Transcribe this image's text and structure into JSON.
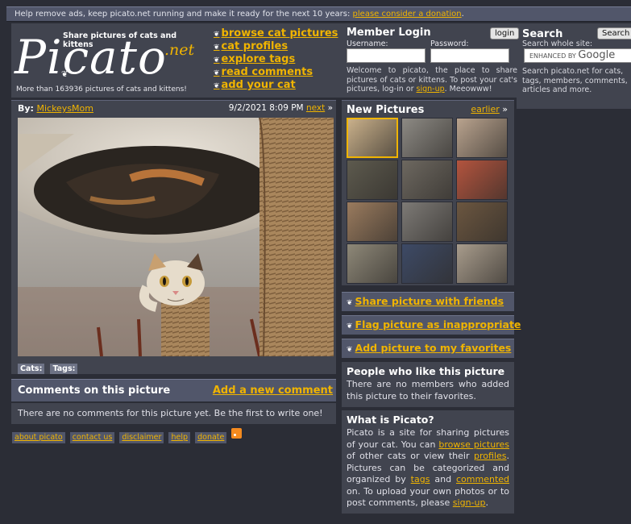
{
  "topbar": {
    "text": "Help remove ads, keep picato.net running and make it ready for the next 10 years:",
    "link": "please consider a donation",
    "tail": "."
  },
  "logo": {
    "tagline": "Share pictures of cats and kittens",
    "word": "Picato",
    "net": ".net",
    "count": "More than 163936 pictures of cats and kittens!"
  },
  "nav": [
    "browse cat pictures",
    "cat profiles",
    "explore tags",
    "read comments",
    "add your cat"
  ],
  "login": {
    "title": "Member Login",
    "button": "login",
    "username_label": "Username:",
    "password_label": "Password:",
    "welcome_text": "Welcome to picato, the place to share pictures of cats or kittens. To post your cat's pictures, log-in or",
    "welcome_link": "sign-up",
    "welcome_tail": ". Meeowww!"
  },
  "search": {
    "title": "Search",
    "button": "Search",
    "sub": "Search whole site:",
    "google_prefix": "ENHANCED BY",
    "google_word": "Google",
    "desc": "Search picato.net for cats, tags, members, comments, articles and more."
  },
  "picture": {
    "by_label": "By:",
    "author": "MickeysMom",
    "datetime": "9/2/2021 8:09 PM",
    "next": "next",
    "next_arrow": "»",
    "cats_label": "Cats:",
    "tags_label": "Tags:"
  },
  "comments": {
    "title": "Comments on this picture",
    "add": "Add a new comment",
    "empty": "There are no comments for this picture yet. Be the first to write one!"
  },
  "footer": [
    "about picato",
    "contact us",
    "disclaimer",
    "help",
    "donate"
  ],
  "new_pictures": {
    "title": "New Pictures",
    "earlier": "earlier",
    "earlier_arrow": "»",
    "thumb_colors": [
      "#c9b08a",
      "#8d8a84",
      "#b9a38e",
      "#5d5a4e",
      "#6d6860",
      "#b3543e",
      "#9a7b5e",
      "#7d7a76",
      "#6b5640",
      "#8e8878",
      "#3d4a66",
      "#a89c8c"
    ]
  },
  "actions": [
    "Share picture with friends",
    "Flag picture as inappropriate",
    "Add picture to my favorites"
  ],
  "likes": {
    "title": "People who like this picture",
    "text": "There are no members who added this picture to their favorites."
  },
  "about": {
    "title": "What is Picato?",
    "t1": "Picato is a site for sharing pictures of your cat. You can",
    "l1": "browse pictures",
    "t2": "of other cats or view their",
    "l2": "profiles",
    "t3": ". Pictures can be categorized and organized by",
    "l3": "tags",
    "t4": "and",
    "l4": "commented",
    "t5": "on. To upload your own photos or to post comments, please",
    "l5": "sign-up",
    "t6": "."
  },
  "colors": {
    "accent": "#f0b400",
    "panel": "#41444f",
    "bar": "#51566a",
    "page": "#2b2d36"
  }
}
